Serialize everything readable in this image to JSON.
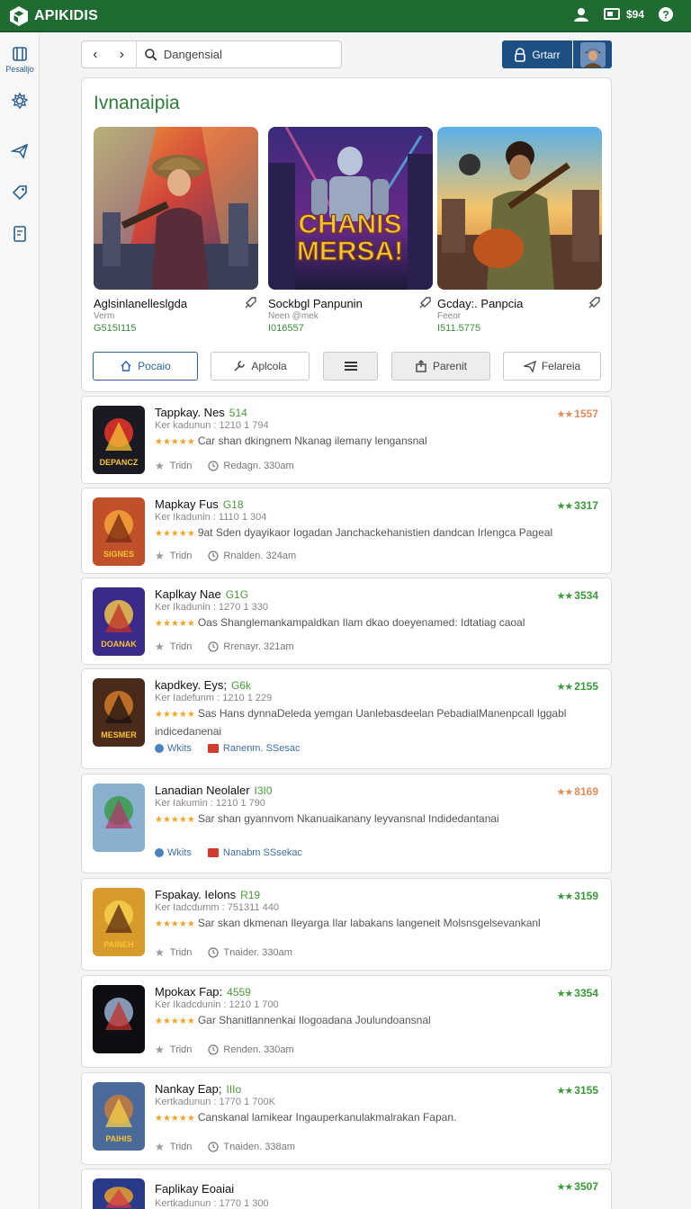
{
  "topbar": {
    "logo_text": "APIKIDIS",
    "count": "$94",
    "icons": [
      "user-icon",
      "screen-icon",
      "help-icon"
    ],
    "color": "#1f6b31"
  },
  "sidebar": {
    "items": [
      {
        "icon": "library-icon",
        "label": "Pesalljo"
      },
      {
        "icon": "settings-icon",
        "label": ""
      },
      {
        "icon": "send-icon",
        "label": ""
      },
      {
        "icon": "tag-icon",
        "label": ""
      },
      {
        "icon": "document-icon",
        "label": ""
      }
    ]
  },
  "nav": {
    "back": "‹",
    "forward": "›",
    "search_value": "Dangensial",
    "primary_button": "Grtarr"
  },
  "featured": {
    "title": "Ivnanaipia",
    "cards": [
      {
        "name": "Aglsinlanelleslgda",
        "sub": "Verm",
        "num": "G515I115"
      },
      {
        "name": "Sockbgl Panpunin",
        "sub": "Neen @mek",
        "num": "I016557",
        "art_text_1": "CHANIS",
        "art_text_2": "MERSA!"
      },
      {
        "name": "Gcday:. Panpcia",
        "sub": "Feeor",
        "num": "I511.5775"
      }
    ],
    "buttons": [
      {
        "label": "Pocaio",
        "icon": "home-icon"
      },
      {
        "label": "Aplcola",
        "icon": "tool-icon"
      },
      {
        "label": "",
        "icon": "list-icon"
      },
      {
        "label": "Parenit",
        "icon": "share-icon"
      },
      {
        "label": "Felareia",
        "icon": "send-icon"
      }
    ]
  },
  "apps": [
    {
      "name": "Tappkay. Nes",
      "ver": "514",
      "meta": "Ker kadunun : 1210 1 794",
      "desc": "Car shan dkingnem Nkanag ilemany lengansnal",
      "foot_type": "time",
      "foot1": "Tridn",
      "foot2": "Redagn. 330am",
      "rating": "1557",
      "rating_color": "#e58b5a",
      "icon_text": "DEPANCZ"
    },
    {
      "name": "Mapkay Fus",
      "ver": "G18",
      "meta": "Ker Ikadunin : 1110 1 304",
      "desc": "9at Sden dyayikaor Iogadan Janchackehanistien dandcan Irlengca Pageal",
      "foot_type": "time",
      "foot1": "Tridn",
      "foot2": "Rnalden. 324am",
      "rating": "3317",
      "rating_color": "#3a9a3a",
      "icon_text": "SIGNES"
    },
    {
      "name": "Kaplkay Nae",
      "ver": "G1G",
      "meta": "Ker Ikadunin : 1270 1 330",
      "desc": "Oas Shanglemankampaldkan Ilam dkao doeyenamed: Idtatiag caoal",
      "foot_type": "time",
      "foot1": "Tridn",
      "foot2": "Rrenayr. 321am",
      "rating": "3534",
      "rating_color": "#3a9a3a",
      "icon_text": "DOANAK"
    },
    {
      "name": "kapdkey. Eys;",
      "ver": "G6k",
      "meta": "Ker Iadefunm : 1210 1 229",
      "desc": "Sas Hans dynnaDeleda yemgan Uanlebasdeelan PebadialManenpcall Iggabl indicedanenai",
      "foot_type": "link",
      "foot1": "Wkits",
      "foot2": "Ranenm. SSesac",
      "rating": "2155",
      "rating_color": "#3a9a3a",
      "icon_text": "MESMER"
    },
    {
      "name": "Lanadian Neolaler",
      "ver": "I3I0",
      "meta": "Ker Iakumin : 1210 1 790",
      "desc": "Sar shan gyannvom Nkanuaikanany leyvansnal Indidedantanai",
      "foot_type": "link",
      "foot1": "Wkits",
      "foot2": "Nanabm SSsekac",
      "rating": "8169",
      "rating_color": "#e58b5a",
      "icon_text": ""
    },
    {
      "name": "Fspakay. Ielons",
      "ver": "R19",
      "meta": "Ker Iadcdumm : 751311 440",
      "desc": "Sar skan dkmenan Ileyarga Ilar labakans langeneit Molsnsgelsevankanl",
      "foot_type": "time",
      "foot1": "Tridn",
      "foot2": "Tnaider. 330am",
      "rating": "3159",
      "rating_color": "#3a9a3a",
      "icon_text": "PAINEH"
    },
    {
      "name": "Mpokax Fap:",
      "ver": "4559",
      "meta": "Ker Ikadcdunin : 1210 1 700",
      "desc": "Gar Shanitlannenkai Ilogoadana Joulundoansnal",
      "foot_type": "time",
      "foot1": "Tridn",
      "foot2": "Renden. 330am",
      "rating": "3354",
      "rating_color": "#3a9a3a",
      "icon_text": ""
    },
    {
      "name": "Nankay Eap;",
      "ver": "IIIo",
      "meta": "Kertkadunun : 1770 1 700K",
      "desc": "Canskanal lamikear Ingauperkanulakmalrakan Fapan.",
      "foot_type": "time",
      "foot1": "Tridn",
      "foot2": "Tnaiden. 338am",
      "rating": "3155",
      "rating_color": "#3a9a3a",
      "icon_text": "PAIHIS"
    },
    {
      "name": "Faplikay Eoaiai",
      "ver": "",
      "meta": "Kertkadunun : 1770 1 300",
      "desc": "",
      "foot_type": "none",
      "foot1": "",
      "foot2": "",
      "rating": "3507",
      "rating_color": "#3a9a3a",
      "icon_text": ""
    }
  ]
}
